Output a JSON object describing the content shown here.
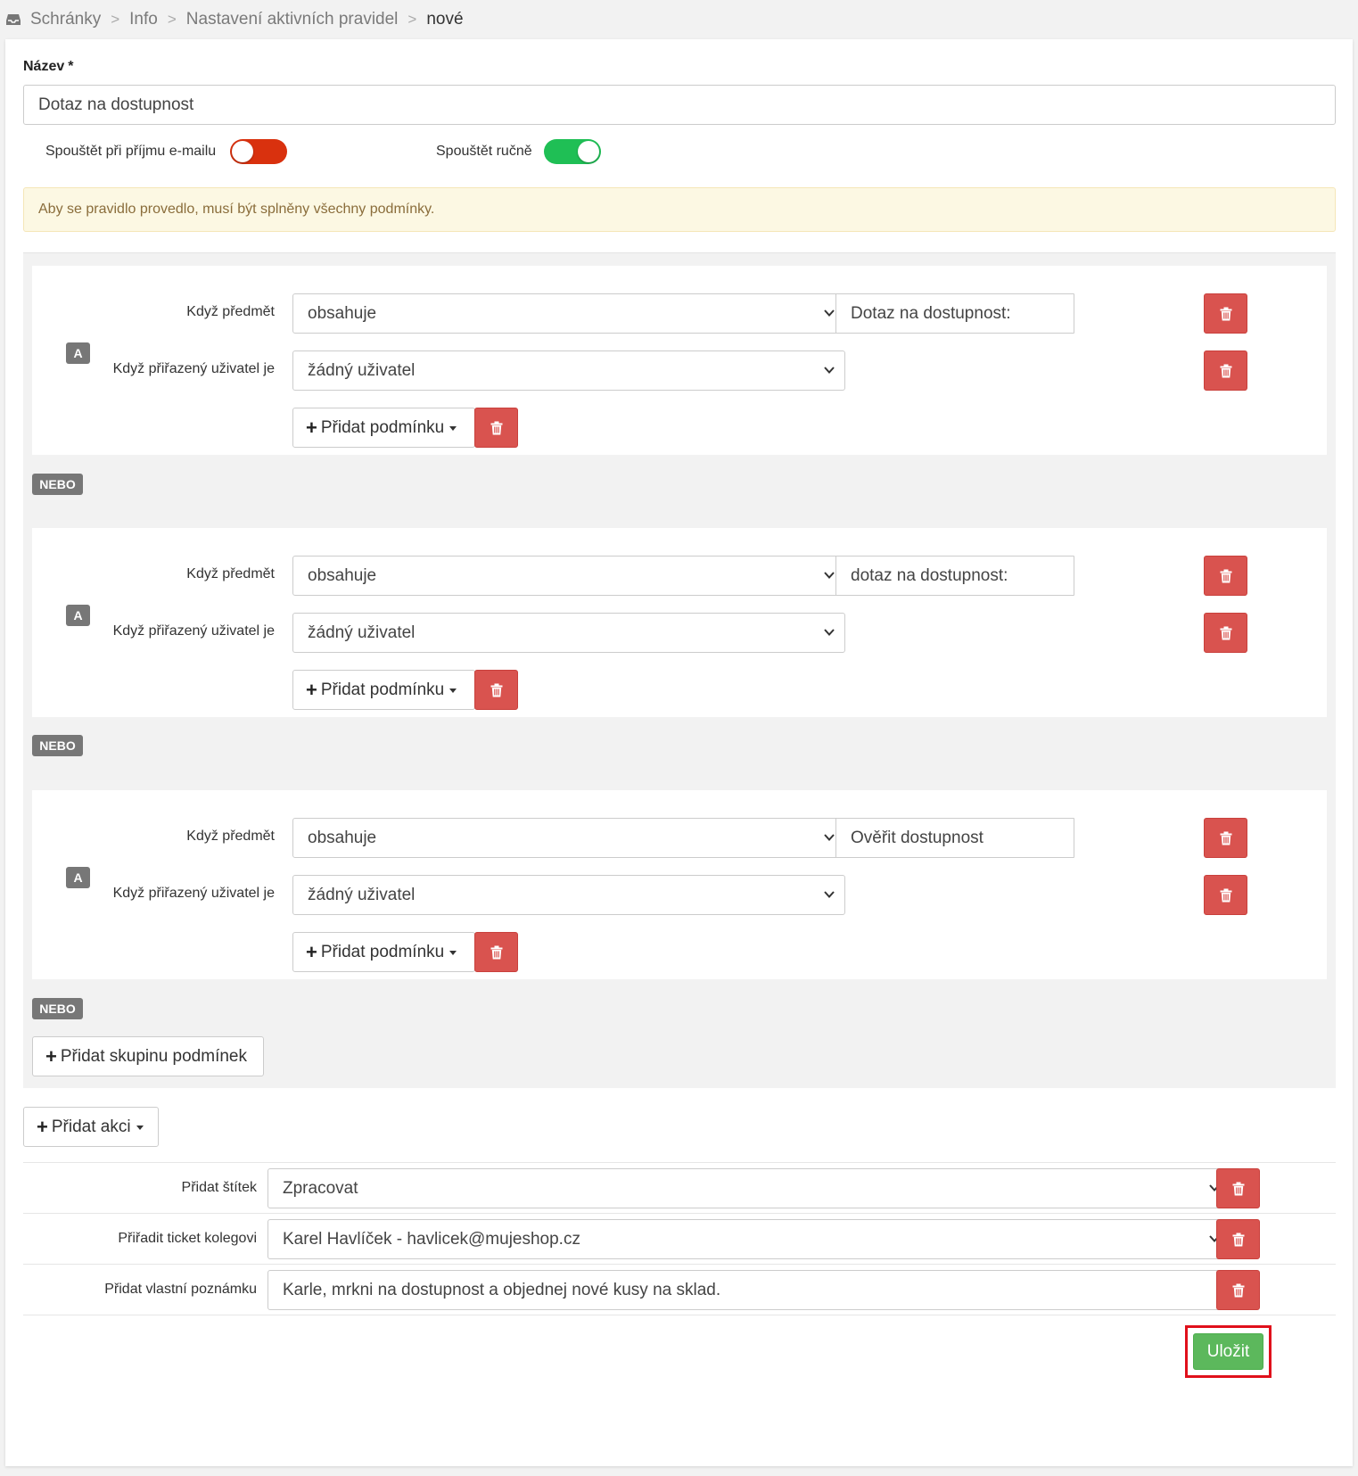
{
  "breadcrumb": {
    "items": [
      "Schránky",
      "Info",
      "Nastavení aktivních pravidel"
    ],
    "current": "nové",
    "separator": ">"
  },
  "form": {
    "name_label": "Název",
    "required_mark": "*",
    "name_value": "Dotaz na dostupnost",
    "toggle_on_receive_label": "Spouštět při příjmu e-mailu",
    "toggle_on_receive_state": "off",
    "toggle_manual_label": "Spouštět ručně",
    "toggle_manual_state": "on",
    "alert_text": "Aby se pravidlo provedlo, musí být splněny všechny podmínky."
  },
  "condition_groups": [
    {
      "badge": "A",
      "conditions": [
        {
          "label": "Když předmět",
          "operator": "obsahuje",
          "value": "Dotaz na dostupnost:"
        },
        {
          "label": "Když přiřazený uživatel je",
          "operator": "žádný uživatel"
        }
      ],
      "add_condition_label": "Přidat podmínku",
      "separator": "NEBO"
    },
    {
      "badge": "A",
      "conditions": [
        {
          "label": "Když předmět",
          "operator": "obsahuje",
          "value": "dotaz na dostupnost:"
        },
        {
          "label": "Když přiřazený uživatel je",
          "operator": "žádný uživatel"
        }
      ],
      "add_condition_label": "Přidat podmínku",
      "separator": "NEBO"
    },
    {
      "badge": "A",
      "conditions": [
        {
          "label": "Když předmět",
          "operator": "obsahuje",
          "value": "Ověřit dostupnost"
        },
        {
          "label": "Když přiřazený uživatel je",
          "operator": "žádný uživatel"
        }
      ],
      "add_condition_label": "Přidat podmínku",
      "separator": "NEBO"
    }
  ],
  "add_group_label": "Přidat skupinu podmínek",
  "add_action_label": "Přidat akci",
  "actions": [
    {
      "label": "Přidat štítek",
      "value": "Zpracovat",
      "kind": "select"
    },
    {
      "label": "Přiřadit ticket kolegovi",
      "value": "Karel Havlíček - havlicek@mujeshop.cz",
      "kind": "select"
    },
    {
      "label": "Přidat vlastní poznámku",
      "value": "Karle, mrkni na dostupnost a objednej nové kusy na sklad.",
      "kind": "input"
    }
  ],
  "save_label": "Uložit",
  "colors": {
    "danger": "#d9534f",
    "success": "#5cb85c",
    "toggle_off": "#d9310e",
    "toggle_on": "#1fbf55",
    "highlight": "#e0101b"
  },
  "icons": {
    "breadcrumb": "inbox-icon",
    "delete": "trash-icon",
    "add": "plus-icon",
    "dropdown": "chevron-down-icon"
  }
}
